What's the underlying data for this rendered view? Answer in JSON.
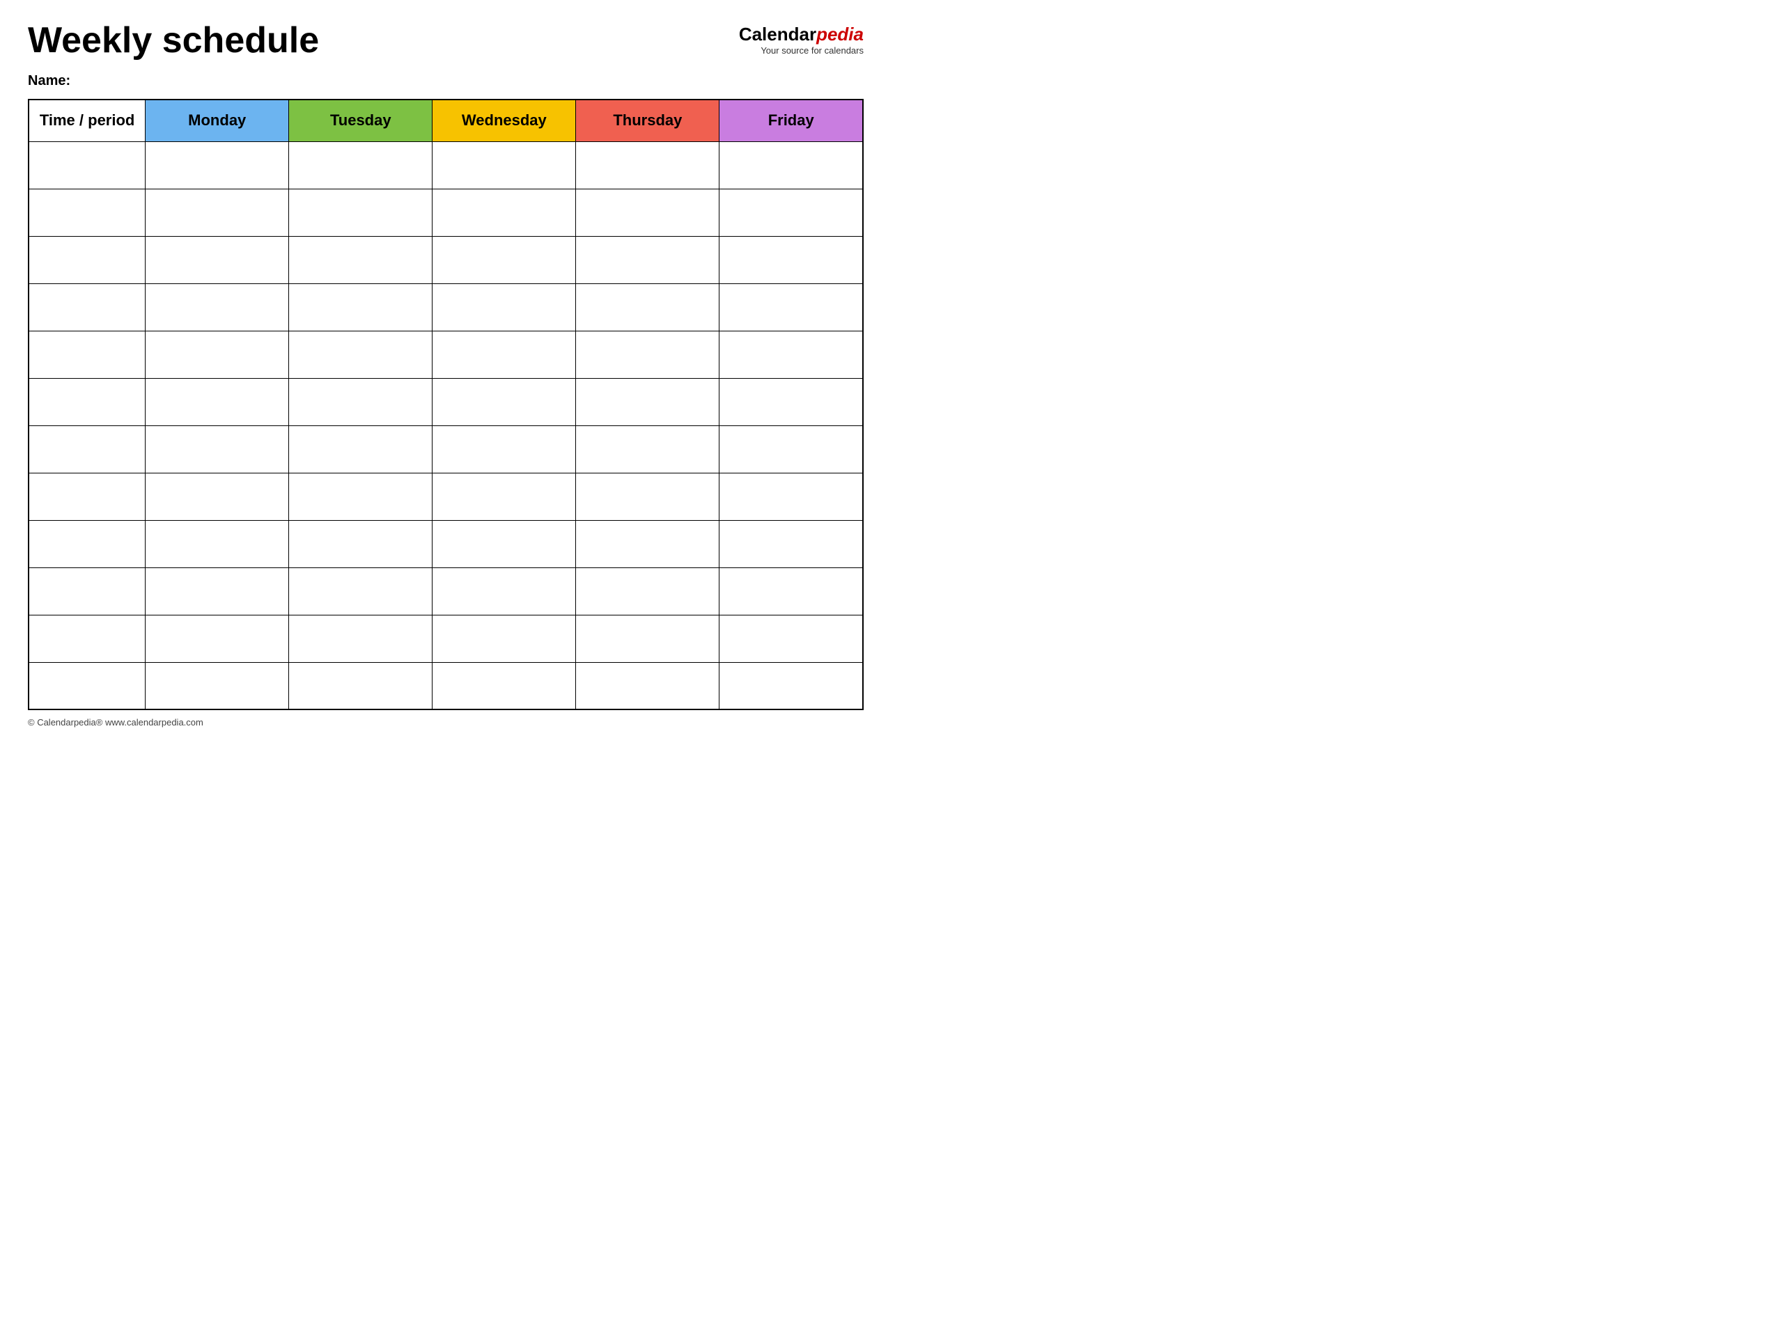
{
  "page": {
    "title": "Weekly schedule",
    "name_label": "Name:",
    "footer": "© Calendarpedia®  www.calendarpedia.com"
  },
  "logo": {
    "calendar": "Calendar",
    "pedia": "pedia",
    "tagline": "Your source for calendars"
  },
  "table": {
    "headers": [
      {
        "key": "time",
        "label": "Time / period",
        "color_class": "col-time"
      },
      {
        "key": "monday",
        "label": "Monday",
        "color_class": "col-monday"
      },
      {
        "key": "tuesday",
        "label": "Tuesday",
        "color_class": "col-tuesday"
      },
      {
        "key": "wednesday",
        "label": "Wednesday",
        "color_class": "col-wednesday"
      },
      {
        "key": "thursday",
        "label": "Thursday",
        "color_class": "col-thursday"
      },
      {
        "key": "friday",
        "label": "Friday",
        "color_class": "col-friday"
      }
    ],
    "row_count": 12
  }
}
